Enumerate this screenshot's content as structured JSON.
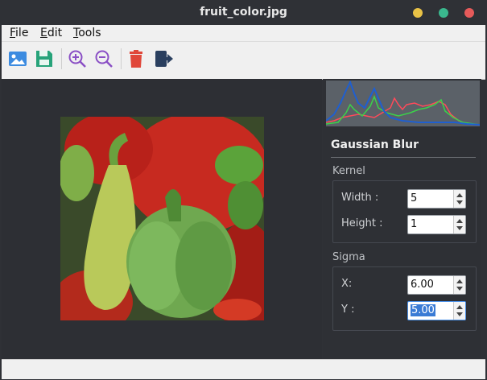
{
  "window": {
    "title": "fruit_color.jpg",
    "controls": [
      "minimize",
      "maximize",
      "close"
    ],
    "control_colors": {
      "minimize": "#e9c246",
      "maximize": "#3ab88e",
      "close": "#e65a5a"
    }
  },
  "menu": {
    "file": {
      "mnemonic": "F",
      "rest": "ile"
    },
    "edit": {
      "mnemonic": "E",
      "rest": "dit"
    },
    "tools": {
      "mnemonic": "T",
      "rest": "ools"
    }
  },
  "toolbar": {
    "icons": [
      "open-image-icon",
      "save-icon",
      "zoom-in-icon",
      "zoom-out-icon",
      "delete-icon",
      "exit-icon"
    ]
  },
  "image": {
    "description_icon": "peppers-photo"
  },
  "panel": {
    "title": "Gaussian Blur",
    "kernel": {
      "label": "Kernel",
      "width_label": "Width :",
      "width_value": "5",
      "height_label": "Height :",
      "height_value": "1"
    },
    "sigma": {
      "label": "Sigma",
      "x_label": "X:",
      "x_value": "6.00",
      "y_label": "Y :",
      "y_value": "5.00"
    }
  },
  "histogram": {
    "channels": [
      "blue",
      "green",
      "red"
    ],
    "colors": {
      "blue": "#1f5fd0",
      "green": "#3bd24a",
      "red": "#ff4a5a"
    }
  }
}
